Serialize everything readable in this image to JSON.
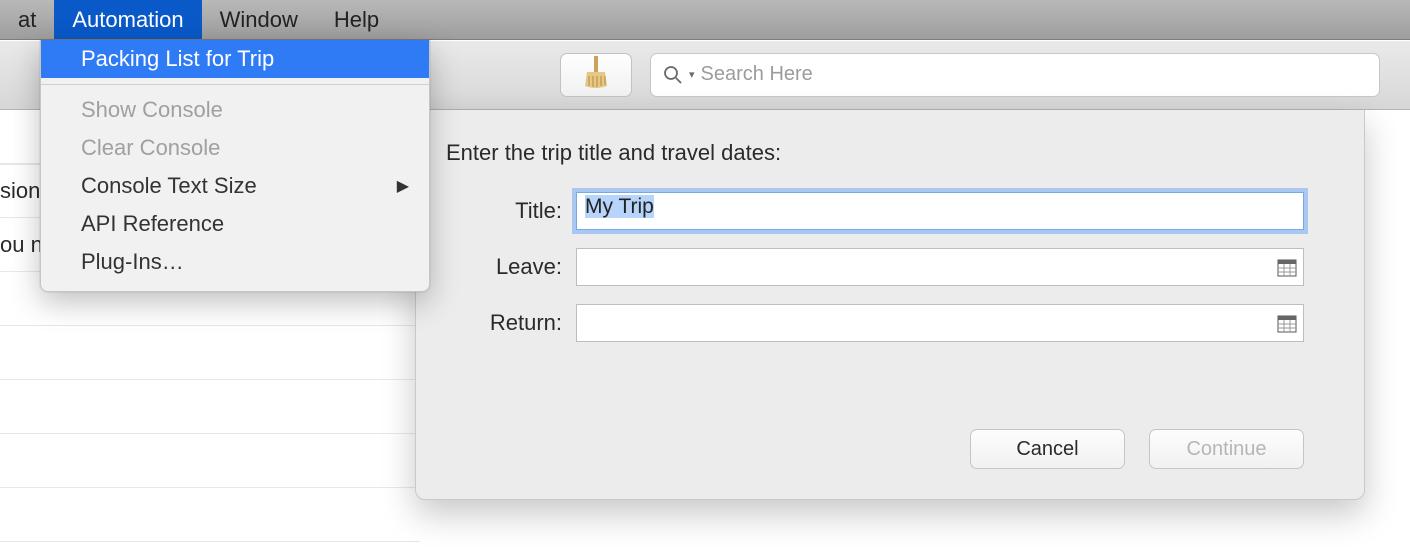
{
  "menubar": {
    "items": [
      {
        "label": "at",
        "active": false
      },
      {
        "label": "Automation",
        "active": true
      },
      {
        "label": "Window",
        "active": false
      },
      {
        "label": "Help",
        "active": false
      }
    ]
  },
  "dropdown": {
    "highlighted": "Packing List for Trip",
    "items": [
      {
        "label": "Show Console",
        "disabled": true
      },
      {
        "label": "Clear Console",
        "disabled": true
      },
      {
        "label": "Console Text Size",
        "submenu": true
      },
      {
        "label": "API Reference"
      },
      {
        "label": "Plug-Ins…"
      }
    ]
  },
  "toolbar": {
    "brush_icon": "cleanup-icon",
    "search_placeholder": "Search Here"
  },
  "left_list": {
    "rows": [
      "",
      "sion",
      "ou notes",
      "",
      "",
      "",
      "",
      ""
    ]
  },
  "dialog": {
    "prompt": "Enter the trip title and travel dates:",
    "fields": {
      "title_label": "Title:",
      "title_value": "My Trip",
      "leave_label": "Leave:",
      "leave_value": "",
      "return_label": "Return:",
      "return_value": ""
    },
    "buttons": {
      "cancel": "Cancel",
      "continue": "Continue"
    }
  }
}
